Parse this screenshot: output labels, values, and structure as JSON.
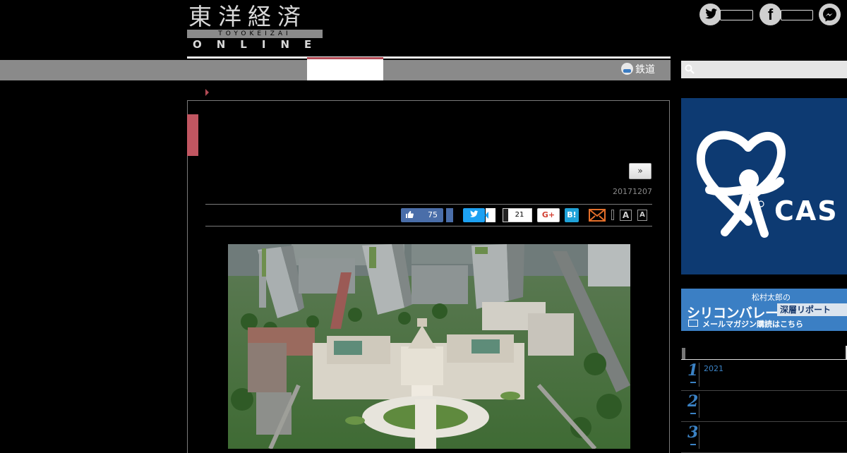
{
  "logo": {
    "kanji": "東洋経済",
    "sub": "TOYOKEIZAI",
    "online": "ONLINE"
  },
  "social": {
    "twitter_icon": "twitter-icon",
    "facebook_icon": "facebook-icon",
    "messenger_icon": "messenger-icon"
  },
  "nav": {
    "rail_label": "鉄道"
  },
  "search": {
    "placeholder": ""
  },
  "article": {
    "more_label": "»",
    "date": "20171207"
  },
  "share": {
    "like_count": "75",
    "pocket_count": "21",
    "gplus_label": "G+",
    "hatena_label": "B!",
    "font_large": "A",
    "font_small": "A"
  },
  "sidebar": {
    "ad1_text": "CAS",
    "ad2": {
      "line1": "松村太郎の",
      "line2": "シリコンバレー",
      "badge": "深層リポート",
      "line4": "メールマガジン購読はこちら"
    },
    "ranking": [
      {
        "rank": "1",
        "text": "2021"
      },
      {
        "rank": "2",
        "text": ""
      },
      {
        "rank": "3",
        "text": ""
      }
    ]
  },
  "colors": {
    "accent": "#b34a55",
    "facebook_blue": "#4a6ea9",
    "twitter_blue": "#1da1f2",
    "hatena_blue": "#1fa2d9",
    "ad_navy": "#0d3a72",
    "rank_blue": "#3b82c4"
  }
}
